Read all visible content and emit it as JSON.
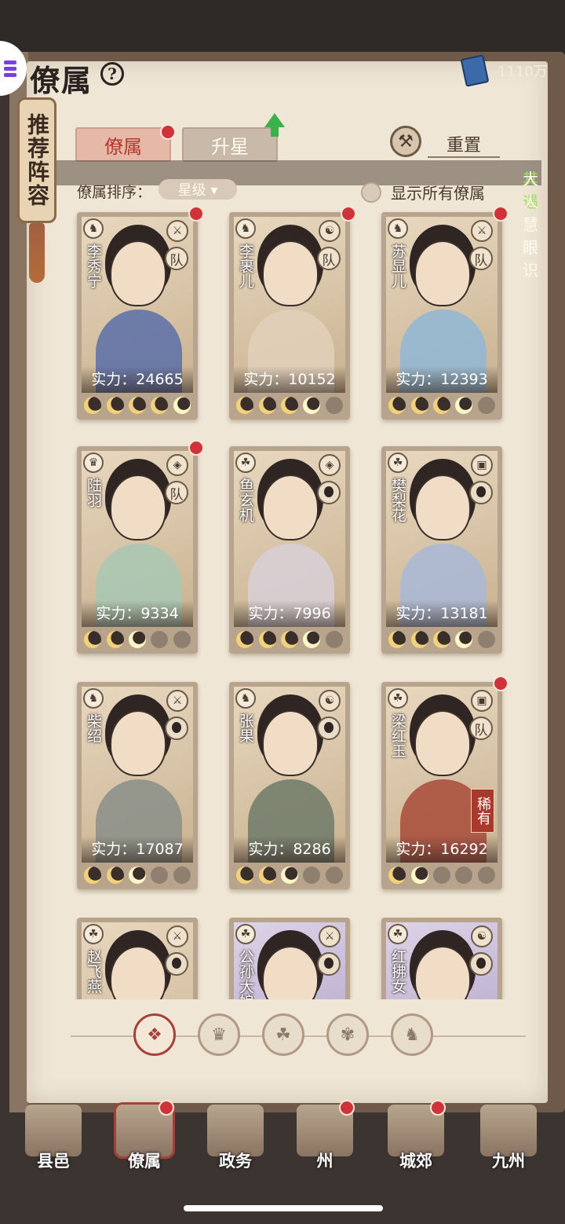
{
  "header": {
    "title": "僚属",
    "currency_value": "1110万"
  },
  "side_scroll": {
    "label": "推荐阵容"
  },
  "tabs": [
    {
      "label": "僚属",
      "active": true
    },
    {
      "label": "升星",
      "active": false
    }
  ],
  "reset_label": "重置",
  "banner": {
    "highlight": "其遇",
    "text": "大人慧眼识"
  },
  "sort": {
    "label": "僚属排序：",
    "selected": "星级 ▾"
  },
  "show_all_label": "显示所有僚属",
  "characters": [
    {
      "name": "李秀宁",
      "power": "实力：24665",
      "stars_on": 5,
      "team": "队",
      "reddot": true,
      "body": "#5a6fa8",
      "cls": "♞",
      "wpn": "⚔"
    },
    {
      "name": "李裹儿",
      "power": "实力：10152",
      "stars_on": 4,
      "team": "队",
      "reddot": true,
      "body": "#e2d0bb",
      "cls": "♞",
      "wpn": "☯"
    },
    {
      "name": "苏显儿",
      "power": "实力：12393",
      "stars_on": 4,
      "team": "队",
      "reddot": true,
      "body": "#8fb7d6",
      "cls": "♞",
      "wpn": "⚔"
    },
    {
      "name": "陆羽",
      "power": "实力：9334",
      "stars_on": 3,
      "team": "队",
      "reddot": true,
      "body": "#a8c8b4",
      "cls": "♛",
      "wpn": "◈"
    },
    {
      "name": "鱼玄机",
      "power": "实力：7996",
      "stars_on": 4,
      "team": "",
      "reddot": false,
      "body": "#d8d0d8",
      "cls": "☘",
      "wpn": "◈"
    },
    {
      "name": "樊梨花",
      "power": "实力：13181",
      "stars_on": 4,
      "team": "",
      "reddot": false,
      "body": "#a8b8d8",
      "cls": "☘",
      "wpn": "▣"
    },
    {
      "name": "柴绍",
      "power": "实力：17087",
      "stars_on": 3,
      "team": "",
      "reddot": false,
      "body": "#8a8f8a",
      "cls": "♞",
      "wpn": "⚔"
    },
    {
      "name": "张果",
      "power": "实力：8286",
      "stars_on": 3,
      "team": "",
      "reddot": false,
      "body": "#6f7a68",
      "cls": "♞",
      "wpn": "☯"
    },
    {
      "name": "梁红玉",
      "power": "实力：16292",
      "stars_on": 2,
      "team": "队",
      "rare": "稀有",
      "reddot": true,
      "body": "#a84a3a",
      "cls": "☘",
      "wpn": "▣"
    }
  ],
  "partial_characters": [
    {
      "name": "赵飞燕",
      "cls": "☘",
      "wpn": "⚔"
    },
    {
      "name": "公孙大娘",
      "cls": "☘",
      "wpn": "⚔"
    },
    {
      "name": "红拂女",
      "cls": "☘",
      "wpn": "☯"
    }
  ],
  "filters": [
    {
      "icon": "❖",
      "active": true
    },
    {
      "icon": "♛",
      "active": false
    },
    {
      "icon": "☘",
      "active": false
    },
    {
      "icon": "✾",
      "active": false
    },
    {
      "icon": "♞",
      "active": false
    }
  ],
  "nav": [
    {
      "label": "县邑",
      "reddot": false,
      "active": false
    },
    {
      "label": "僚属",
      "reddot": true,
      "active": true
    },
    {
      "label": "政务",
      "reddot": false,
      "active": false
    },
    {
      "label": "州",
      "reddot": true,
      "active": false
    },
    {
      "label": "城郊",
      "reddot": true,
      "active": false
    },
    {
      "label": "九州",
      "reddot": false,
      "active": false
    }
  ]
}
